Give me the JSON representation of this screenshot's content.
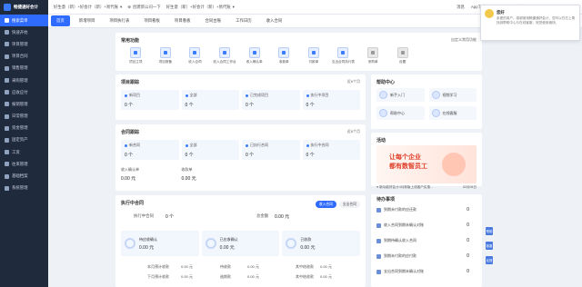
{
  "app": {
    "logo_text": "畅捷通好会计",
    "logo_sub": "项目版"
  },
  "sidebar": {
    "items": [
      {
        "label": "搜索菜单"
      },
      {
        "label": "快速开始"
      },
      {
        "label": "项目管理"
      },
      {
        "label": "项目合同"
      },
      {
        "label": "销售管理"
      },
      {
        "label": "采购管理"
      },
      {
        "label": "应收应付"
      },
      {
        "label": "报销管理"
      },
      {
        "label": "日常管理"
      },
      {
        "label": "资金管理"
      },
      {
        "label": "固定资产"
      },
      {
        "label": "工资"
      },
      {
        "label": "往来管理"
      },
      {
        "label": "基础档案"
      },
      {
        "label": "系统管理"
      }
    ]
  },
  "topbar": {
    "account": "好生意（新）+好会计（新）+易代账",
    "org": "创建新公司一下",
    "org2": "好生意（新）+好会计（新）+易代账",
    "links": [
      "消息",
      "App下载",
      "在线客服",
      "畅捷通用户"
    ]
  },
  "tabs": [
    "首页",
    "新增项目",
    "项目执行表",
    "项目看板",
    "项目看板",
    "合同台账",
    "工作日历",
    "收入合同"
  ],
  "quick": {
    "title": "常用功能",
    "setting": "自定义常用功能",
    "items": [
      "项目立项",
      "项目报备",
      "收入合同",
      "收入合同工作台",
      "收入确认单",
      "收款单",
      "付款单",
      "支出合同执行表",
      "采购单",
      "设置"
    ]
  },
  "project_summary": {
    "title": "项目跟踪",
    "period": "近6个月",
    "stats": [
      {
        "label": "新项目",
        "value": "0 个"
      },
      {
        "label": "全部",
        "value": "0 个"
      },
      {
        "label": "已完成项目",
        "value": "0 个"
      },
      {
        "label": "执行中项目",
        "value": "0 个"
      }
    ]
  },
  "contract_summary": {
    "title": "合同跟踪",
    "period": "近6个月",
    "stats": [
      {
        "label": "新合同",
        "value": "0 个"
      },
      {
        "label": "全部",
        "value": "0 个"
      },
      {
        "label": "已执行合同",
        "value": "0 个"
      },
      {
        "label": "执行中合同",
        "value": "0 个"
      }
    ],
    "income_label": "收入确认单",
    "income_value": "0.00 元",
    "collect_label": "收款单",
    "collect_value": "0.00 元"
  },
  "executing": {
    "title": "执行中合同",
    "btn_income": "收入合同",
    "btn_expense": "支出合同",
    "count_label": "执行中合同",
    "count_value": "0 个",
    "total_label": "总金额",
    "total_value": "0.00 元",
    "progress": [
      {
        "label": "待应收确认",
        "value": "0.00 元"
      },
      {
        "label": "已应收确认",
        "value": "0.00 元"
      },
      {
        "label": "已收款",
        "value": "0.00 元"
      }
    ],
    "rows": [
      {
        "a": "本月预计收款",
        "b": "0.00 元",
        "c": "待收款",
        "d": "0.00 元",
        "e": "其中结收款",
        "f": "0.00 元"
      },
      {
        "a": "下月预计收款",
        "b": "0.00 元",
        "c": "逾期款",
        "d": "0.00 元",
        "e": "其中结收款",
        "f": "0.00 元"
      }
    ]
  },
  "help": {
    "title": "帮助中心",
    "items": [
      "新手入门",
      "视频学习",
      "帮助中心",
      "在线客服"
    ]
  },
  "activity": {
    "title": "活动",
    "banner_line1": "让每个企业",
    "banner_line2": "都有数智员工",
    "news": [
      {
        "text": "● 新功能好会计4月新版上线客户实惠…",
        "date": "02月08日"
      },
      {
        "text": "● 好会计功能优化：以后可以从报表…",
        "date": "02月17日"
      }
    ]
  },
  "todo": {
    "title": "待办事项",
    "items": [
      {
        "label": "到期未付款的应还款",
        "count": "0"
      },
      {
        "label": "收入合同到期未确认对账",
        "count": "0"
      },
      {
        "label": "到期待确认收入合同",
        "count": "0"
      },
      {
        "label": "到期未付款的应付款",
        "count": "0"
      },
      {
        "label": "支出合同到期未确认对账",
        "count": "0"
      }
    ],
    "sidetabs": [
      "帮助",
      "客服",
      "反馈"
    ]
  },
  "popup": {
    "title": "您好",
    "body": "亲爱的用户，感谢使用畅捷通好会计，您可以在右上角找到帮助中心与在线客服，祝您使用愉快。"
  },
  "colors": {
    "accent": "#2f6bff",
    "sidebar": "#1f2a3d"
  }
}
